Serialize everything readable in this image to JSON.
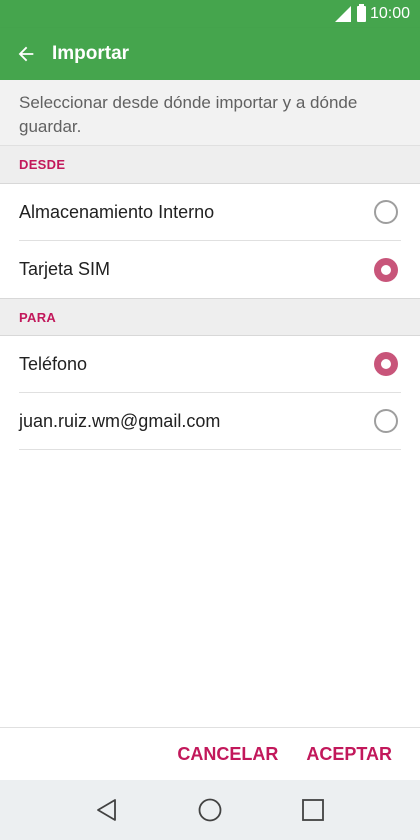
{
  "status_bar": {
    "time": "10:00"
  },
  "app_bar": {
    "title": "Importar"
  },
  "description": "Seleccionar desde dónde importar y a dónde guardar.",
  "sections": {
    "from": {
      "header": "DESDE",
      "options": [
        {
          "label": "Almacenamiento Interno",
          "selected": false
        },
        {
          "label": "Tarjeta SIM",
          "selected": true
        }
      ]
    },
    "to": {
      "header": "PARA",
      "options": [
        {
          "label": "Teléfono",
          "selected": true
        },
        {
          "label": "juan.ruiz.wm@gmail.com",
          "selected": false
        }
      ]
    }
  },
  "actions": {
    "cancel": "CANCELAR",
    "accept": "ACEPTAR"
  },
  "colors": {
    "app_bar": "#45a54d",
    "accent": "#c2185b",
    "radio_selected": "#c8557a"
  },
  "icons": {
    "back": "arrow-back-icon",
    "nav_back": "triangle-back-icon",
    "nav_home": "circle-home-icon",
    "nav_recents": "square-recents-icon"
  }
}
